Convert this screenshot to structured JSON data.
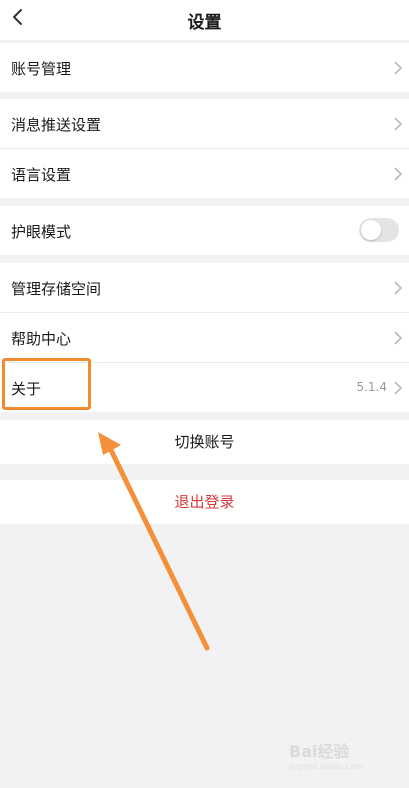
{
  "header": {
    "title": "设置"
  },
  "groups": {
    "account": {
      "account_manage": "账号管理"
    },
    "settings": {
      "push": "消息推送设置",
      "language": "语言设置"
    },
    "eye": {
      "label": "护眼模式",
      "enabled": false
    },
    "misc": {
      "storage": "管理存储空间",
      "help": "帮助中心",
      "about": "关于",
      "version": "5.1.4"
    }
  },
  "actions": {
    "switch_account": "切换账号",
    "logout": "退出登录"
  },
  "colors": {
    "logout_text": "#d93a3a",
    "highlight": "#f28a2e",
    "background": "#f2f2f4"
  },
  "watermark": {
    "brand": "Bai经验",
    "url": "jingyan.baidu.com"
  }
}
